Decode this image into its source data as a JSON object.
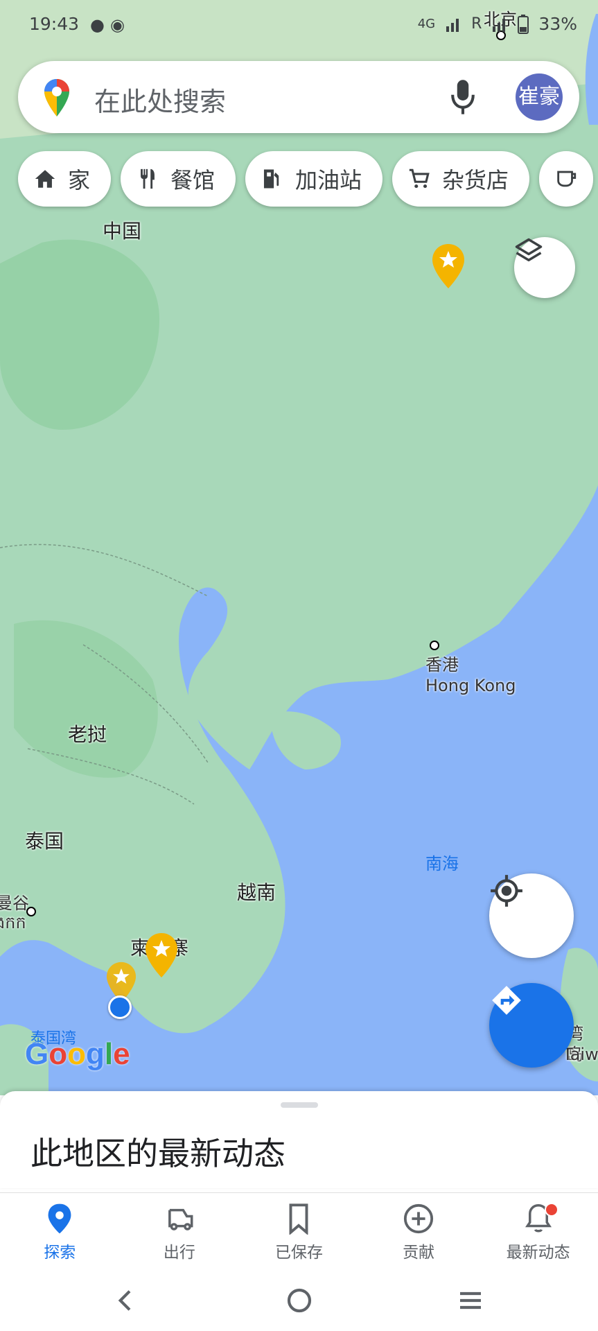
{
  "status_bar": {
    "time": "19:43",
    "network": "4G",
    "roaming": "R",
    "battery": "33%",
    "left_icons": [
      "music-icon",
      "wechat-icon"
    ]
  },
  "search": {
    "placeholder": "在此处搜索",
    "avatar_text": "崔豪"
  },
  "chips": [
    {
      "label": "家",
      "icon": "home-icon"
    },
    {
      "label": "餐馆",
      "icon": "restaurant-icon"
    },
    {
      "label": "加油站",
      "icon": "gas-station-icon"
    },
    {
      "label": "杂货店",
      "icon": "cart-icon"
    }
  ],
  "map_labels": {
    "china": "中国",
    "beijing": "北京",
    "hong_kong_zh": "香港",
    "hong_kong_en": "Hong Kong",
    "laos": "老挝",
    "thailand": "泰国",
    "vietnam": "越南",
    "cambodia": "柬埔寨",
    "bangkok_zh": "曼谷",
    "bangkok_kh": "ងកក",
    "south_sea": "南海",
    "gulf_thailand": "泰国湾",
    "taiwan_zh": "湾岛",
    "taiwan_en": "Taiwan",
    "google": "Google"
  },
  "sheet": {
    "title": "此地区的最新动态"
  },
  "nav": [
    {
      "label": "探索",
      "icon": "explore-pin-icon",
      "active": true
    },
    {
      "label": "出行",
      "icon": "car-icon",
      "active": false
    },
    {
      "label": "已保存",
      "icon": "bookmark-icon",
      "active": false
    },
    {
      "label": "贡献",
      "icon": "add-circle-icon",
      "active": false
    },
    {
      "label": "最新动态",
      "icon": "bell-icon",
      "active": false
    }
  ],
  "colors": {
    "land": "#a8d8b9",
    "water": "#8ab4f8",
    "accent": "#1a73e8",
    "saved_star": "#f4b400"
  }
}
